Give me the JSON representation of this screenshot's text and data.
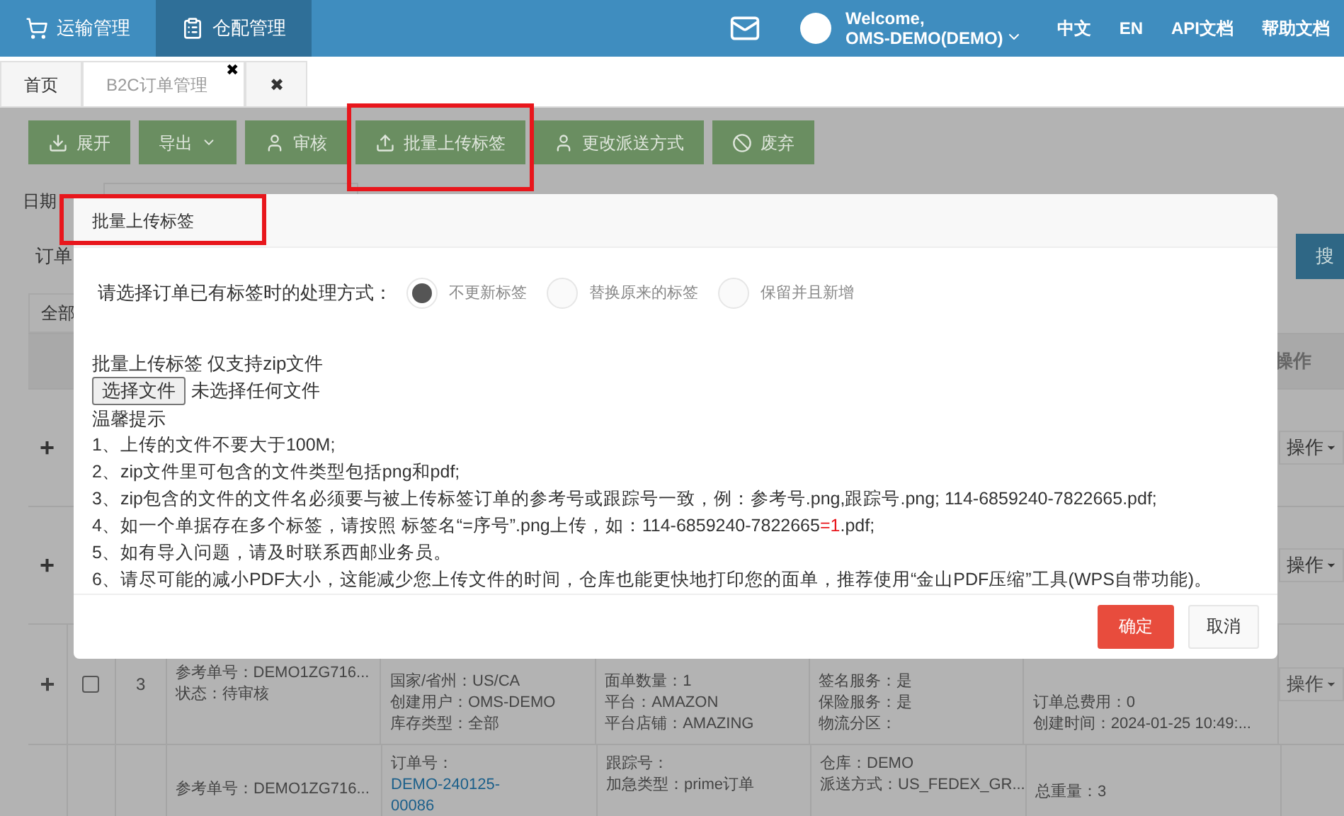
{
  "nav": {
    "items": [
      {
        "label": "运输管理",
        "selected": false
      },
      {
        "label": "仓配管理",
        "selected": true
      }
    ],
    "user": {
      "greeting": "Welcome,",
      "name": "OMS-DEMO(DEMO)"
    },
    "links": [
      "中文",
      "EN",
      "API文档",
      "帮助文档"
    ]
  },
  "tabs": [
    {
      "label": "首页",
      "selected": false
    },
    {
      "label": "B2C订单管理",
      "close": "✖",
      "selected": true
    },
    {
      "label": "✖",
      "selected": false
    }
  ],
  "toolbar": [
    {
      "label": "展开",
      "kind": "expand",
      "caret": false,
      "highlighted": false
    },
    {
      "label": "导出",
      "kind": "plain",
      "caret": true,
      "highlighted": false
    },
    {
      "label": "审核",
      "kind": "user",
      "caret": false,
      "highlighted": false
    },
    {
      "label": "批量上传标签",
      "kind": "upload",
      "caret": false,
      "highlighted": true
    },
    {
      "label": "更改派送方式",
      "kind": "user",
      "caret": false,
      "highlighted": false
    },
    {
      "label": "废弃",
      "kind": "ban",
      "caret": false,
      "highlighted": false
    }
  ],
  "filters": {
    "date_label": "日期",
    "order_label": "订单",
    "search_button": "搜"
  },
  "table": {
    "tab": "全部",
    "ops_header": "操作",
    "hidden_rows": [
      {
        "expand": "+",
        "ops": "操作"
      },
      {
        "expand": "+",
        "ops": "操作"
      }
    ],
    "rows": [
      {
        "expand": "+",
        "index": "3",
        "checked": false,
        "ref": [
          "参考单号：DEMO1ZG716...",
          "状态：待审核"
        ],
        "order": [],
        "col2": [
          "国家/省州：US/CA",
          "创建用户：OMS-DEMO",
          "库存类型：全部"
        ],
        "col3": [
          "面单数量：1",
          "平台：AMAZON",
          "平台店铺：AMAZING"
        ],
        "col4": [
          "签名服务：是",
          "保险服务：是",
          "物流分区："
        ],
        "col5": [
          "订单总费用：0",
          "创建时间：2024-01-25 10:49:..."
        ],
        "ops": "操作"
      },
      {
        "ref": [
          "参考单号：DEMO1ZG716..."
        ],
        "order": [
          "订单号：",
          "DEMO-240125-",
          "00086"
        ],
        "col2": [],
        "col3": [
          "跟踪号：",
          "加急类型：prime订单"
        ],
        "col4": [
          "仓库：DEMO",
          "派送方式：US_FEDEX_GR..."
        ],
        "col5": [
          "总重量：3"
        ]
      }
    ]
  },
  "modal": {
    "title": "批量上传标签",
    "title_highlighted": true,
    "prompt": "请选择订单已有标签时的处理方式：",
    "options": [
      {
        "label": "不更新标签",
        "selected": true
      },
      {
        "label": "替换原来的标签",
        "selected": false
      },
      {
        "label": "保留并且新增",
        "selected": false
      }
    ],
    "upload_label": "批量上传标签 仅支持zip文件",
    "file_button": "选择文件",
    "file_status": "未选择任何文件",
    "tips_title": "温馨提示",
    "tips": [
      [
        {
          "text": "1、上传的文件不要大于100M;",
          "emphasis": false
        }
      ],
      [
        {
          "text": "2、zip文件里可包含的文件类型包括png和pdf;",
          "emphasis": false
        }
      ],
      [
        {
          "text": "3、zip包含的文件的文件名必须要与被上传标签订单的参考号或跟踪号一致，例：参考号.png,跟踪号.png; 114-6859240-7822665.pdf;",
          "emphasis": false
        }
      ],
      [
        {
          "text": "4、如一个单据存在多个标签，请按照 标签名“=序号”.png上传，如：114-6859240-7822665",
          "emphasis": false
        },
        {
          "text": "=1",
          "emphasis": true
        },
        {
          "text": ".pdf;",
          "emphasis": false
        }
      ],
      [
        {
          "text": "5、如有导入问题，请及时联系西邮业务员。",
          "emphasis": false
        }
      ],
      [
        {
          "text": "6、请尽可能的减小PDF大小，这能减少您上传文件的时间，仓库也能更快地打印您的面单，推荐使用“金山PDF压缩”工具(WPS自带功能)。",
          "emphasis": false
        }
      ]
    ],
    "confirm": "确定",
    "cancel": "取消"
  }
}
